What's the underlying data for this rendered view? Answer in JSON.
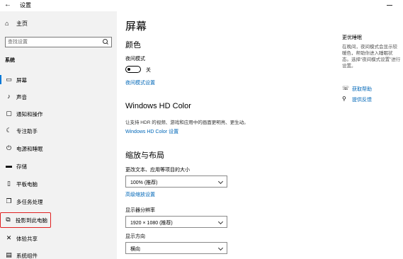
{
  "window": {
    "title": "设置",
    "back_icon": "back-arrow-icon",
    "minimize_icon": "minimize-icon"
  },
  "sidebar": {
    "home": {
      "label": "主页",
      "icon": "home-icon"
    },
    "search": {
      "placeholder": "查找设置",
      "icon": "search-icon"
    },
    "section": "系统",
    "items": [
      {
        "label": "屏幕",
        "icon": "display-icon",
        "glyph": "▭"
      },
      {
        "label": "声音",
        "icon": "speaker-icon",
        "glyph": "♪"
      },
      {
        "label": "通知和操作",
        "icon": "notification-icon",
        "glyph": "▢"
      },
      {
        "label": "专注助手",
        "icon": "moon-icon",
        "glyph": "☾"
      },
      {
        "label": "电源和睡眠",
        "icon": "power-icon",
        "glyph": "⏻"
      },
      {
        "label": "存储",
        "icon": "storage-icon",
        "glyph": "▬"
      },
      {
        "label": "平板电脑",
        "icon": "tablet-icon",
        "glyph": "▯"
      },
      {
        "label": "多任务处理",
        "icon": "multitasking-icon",
        "glyph": "❐"
      },
      {
        "label": "投影到此电脑",
        "icon": "project-icon",
        "glyph": "⧉"
      },
      {
        "label": "体验共享",
        "icon": "share-icon",
        "glyph": "✕"
      },
      {
        "label": "系统组件",
        "icon": "components-icon",
        "glyph": "▤"
      }
    ]
  },
  "main": {
    "title": "屏幕",
    "color_heading": "颜色",
    "night_light_label": "夜间模式",
    "night_light_state": "关",
    "night_light_link": "夜间模式设置",
    "hd_heading": "Windows HD Color",
    "hd_desc": "让支持 HDR 的视频、游戏和应用中的画面更明亮、更生动。",
    "hd_link": "Windows HD Color 设置",
    "scale_heading": "缩放与布局",
    "scale_label": "更改文本、应用等项目的大小",
    "scale_value": "100% (推荐)",
    "advanced_link": "高级缩放设置",
    "resolution_label": "显示器分辨率",
    "resolution_value": "1920 × 1080 (推荐)",
    "orientation_label": "显示方向",
    "orientation_value": "横向"
  },
  "right_panel": {
    "title": "更优睡眠",
    "desc": "在晚间，夜间模式会显示较暖色，帮助你进入睡眠状态。选择“夜间模式设置”进行设置。",
    "links": [
      {
        "label": "获取帮助",
        "icon": "help-icon",
        "glyph": "☏"
      },
      {
        "label": "提供反馈",
        "icon": "feedback-icon",
        "glyph": "⚲"
      }
    ]
  },
  "colors": {
    "accent": "#0078d7",
    "link": "#0067b8",
    "highlight_border": "#e02020",
    "sidebar_bg": "#f2f2f2"
  }
}
